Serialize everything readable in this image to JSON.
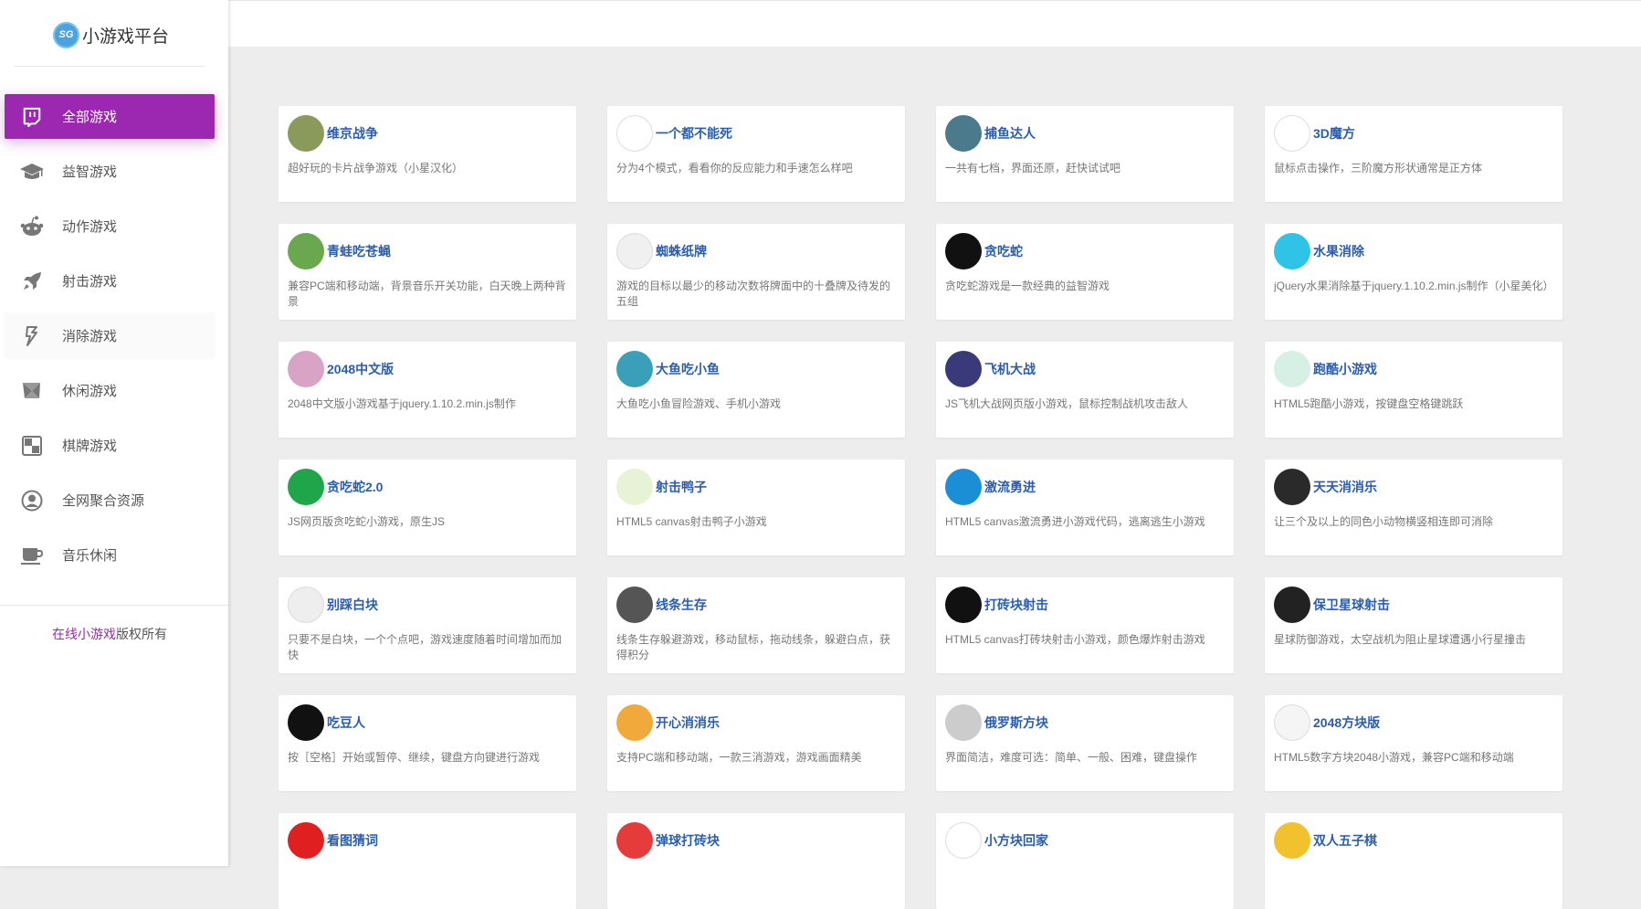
{
  "brand": {
    "badge": "SG",
    "name": "小游戏平台"
  },
  "nav": [
    {
      "label": "全部游戏",
      "icon": "twitch-icon"
    },
    {
      "label": "益智游戏",
      "icon": "graduation-cap-icon"
    },
    {
      "label": "动作游戏",
      "icon": "reddit-robot-icon"
    },
    {
      "label": "射击游戏",
      "icon": "rocket-icon"
    },
    {
      "label": "消除游戏",
      "icon": "puzzle-shuffle-icon"
    },
    {
      "label": "休闲游戏",
      "icon": "pinwheel-icon"
    },
    {
      "label": "棋牌游戏",
      "icon": "checker-board-icon"
    },
    {
      "label": "全网聚合资源",
      "icon": "user-circle-icon"
    },
    {
      "label": "音乐休闲",
      "icon": "coffee-cup-icon"
    }
  ],
  "footer": {
    "site_link": "在线小游戏",
    "suffix": "版权所有"
  },
  "games": [
    {
      "title": "维京战争",
      "desc": "超好玩的卡片战争游戏（小星汉化）",
      "icon": "viking-warrior-icon",
      "color": "#8a9a5b"
    },
    {
      "title": "一个都不能死",
      "desc": "分为4个模式，看看你的反应能力和手速怎么样吧",
      "icon": "running-stickman-icon",
      "color": "#ffffff"
    },
    {
      "title": "捕鱼达人",
      "desc": "一共有七档，界面还原，赶快试试吧",
      "icon": "fishing-net-icon",
      "color": "#4a7a8c"
    },
    {
      "title": "3D魔方",
      "desc": "鼠标点击操作，三阶魔方形状通常是正方体",
      "icon": "rubiks-cube-icon",
      "color": "#ffffff"
    },
    {
      "title": "青蛙吃苍蝇",
      "desc": "兼容PC端和移动端，背景音乐开关功能，白天晚上两种背景",
      "icon": "frog-icon",
      "color": "#6aa84f"
    },
    {
      "title": "蜘蛛纸牌",
      "desc": "游戏的目标以最少的移动次数将牌面中的十叠牌及待发的五组",
      "icon": "playing-card-icon",
      "color": "#f0f0f0"
    },
    {
      "title": "贪吃蛇",
      "desc": "贪吃蛇游戏是一款经典的益智游戏",
      "icon": "snake-icon",
      "color": "#111111"
    },
    {
      "title": "水果消除",
      "desc": "jQuery水果消除基于jquery.1.10.2.min.js制作（小星美化）",
      "icon": "popsicle-icon",
      "color": "#2fc3e8"
    },
    {
      "title": "2048中文版",
      "desc": "2048中文版小游戏基于jquery.1.10.2.min.js制作",
      "icon": "2048-icon",
      "color": "#d9a3c6"
    },
    {
      "title": "大鱼吃小鱼",
      "desc": "大鱼吃小鱼冒险游戏、手机小游戏",
      "icon": "shark-icon",
      "color": "#3a9fb8"
    },
    {
      "title": "飞机大战",
      "desc": "JS飞机大战网页版小游戏，鼠标控制战机攻击敌人",
      "icon": "fighter-plane-icon",
      "color": "#3a3a7a"
    },
    {
      "title": "跑酷小游戏",
      "desc": "HTML5跑酷小游戏，按键盘空格键跳跃",
      "icon": "parkour-runner-icon",
      "color": "#d6f0e6"
    },
    {
      "title": "贪吃蛇2.0",
      "desc": "JS网页版贪吃蛇小游戏，原生JS",
      "icon": "three-dots-icon",
      "color": "#1fa64a"
    },
    {
      "title": "射击鸭子",
      "desc": "HTML5 canvas射击鸭子小游戏",
      "icon": "duck-icon",
      "color": "#e8f2d4"
    },
    {
      "title": "激流勇进",
      "desc": "HTML5 canvas激流勇进小游戏代码，逃离逃生小游戏",
      "icon": "stairs-icon",
      "color": "#1a8fd6"
    },
    {
      "title": "天天消消乐",
      "desc": "让三个及以上的同色小动物横竖相连即可消除",
      "icon": "animal-match-icon",
      "color": "#2a2a2a"
    },
    {
      "title": "别踩白块",
      "desc": "只要不是白块，一个个点吧，游戏速度随着时间增加而加快",
      "icon": "piano-tiles-icon",
      "color": "#eeeeee"
    },
    {
      "title": "线条生存",
      "desc": "线条生存躲避游戏，移动鼠标，拖动线条，躲避白点，获得积分",
      "icon": "dots-survival-icon",
      "color": "#555555"
    },
    {
      "title": "打砖块射击",
      "desc": "HTML5 canvas打砖块射击小游戏，颜色爆炸射击游戏",
      "icon": "brick-shooter-icon",
      "color": "#111111"
    },
    {
      "title": "保卫星球射击",
      "desc": "星球防御游戏，太空战机为阻止星球遭遇小行星撞击",
      "icon": "planet-icon",
      "color": "#222222"
    },
    {
      "title": "吃豆人",
      "desc": "按［空格］开始或暂停、继续，键盘方向键进行游戏",
      "icon": "pacman-icon",
      "color": "#111111"
    },
    {
      "title": "开心消消乐",
      "desc": "支持PC端和移动端，一款三消游戏，游戏画面精美",
      "icon": "candy-icon",
      "color": "#f2a93b"
    },
    {
      "title": "俄罗斯方块",
      "desc": "界面简洁，难度可选：简单、一般、困难，键盘操作",
      "icon": "tetris-icon",
      "color": "#cccccc"
    },
    {
      "title": "2048方块版",
      "desc": "HTML5数字方块2048小游戏，兼容PC端和移动端",
      "icon": "color-grid-icon",
      "color": "#f5f5f5"
    },
    {
      "title": "看图猜词",
      "desc": "",
      "icon": "bottle-icon",
      "color": "#e02020"
    },
    {
      "title": "弹球打砖块",
      "desc": "",
      "icon": "breakout-ball-icon",
      "color": "#e63b3b"
    },
    {
      "title": "小方块回家",
      "desc": "",
      "icon": "block-home-icon",
      "color": "#ffffff"
    },
    {
      "title": "双人五子棋",
      "desc": "",
      "icon": "gomoku-icon",
      "color": "#f2c12e"
    }
  ]
}
